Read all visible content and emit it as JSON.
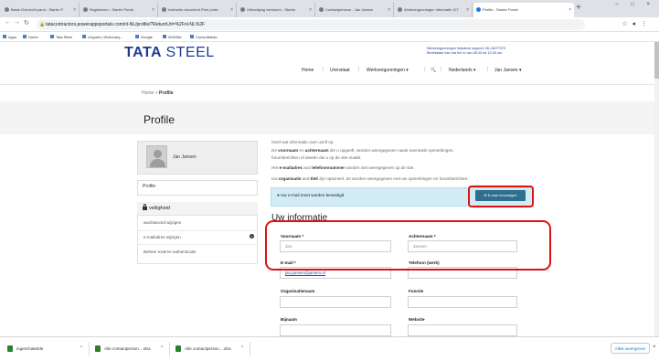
{
  "browser": {
    "tabs": [
      {
        "label": "Basis Overzicht pand - Starter P"
      },
      {
        "label": "Registreren - Starter Portal"
      },
      {
        "label": "Instructie document Prim porta"
      },
      {
        "label": "Uitnodiging versturen - Starter"
      },
      {
        "label": "Contactpersoon - Jan Jansen"
      },
      {
        "label": "Werkvergunningen Informatie ICT"
      },
      {
        "label": "Profile - Starter Portal"
      }
    ],
    "new_tab": "+",
    "window_controls": "– □ ×",
    "url": "tatacontractors.powerappsportals.com/nl-NL/profile/?ReturnUrl=%2Fnl-NL%2F",
    "bookmarks": [
      "Apps",
      "Home",
      "Tata Steel",
      "Linguee | Dictionary...",
      "Google",
      "WvSSet",
      "Consudebalo"
    ]
  },
  "site": {
    "logo_main": "TATA",
    "logo_sub": "STEEL",
    "help_line1": "Werkvergunningen helpdesk support: 06-11677970",
    "help_line2": "Bereikbaar van ma t/m vr van 08.00 tot 12.00 uur",
    "nav": {
      "home": "Home",
      "urenstaat": "Urenstaat",
      "werkvergunningen": "Werkvergunningen ▾",
      "search": "🔍",
      "language": "Nederlands ▾",
      "user": "Jan Jansen ▾"
    }
  },
  "page": {
    "breadcrumb_home": "Home",
    "breadcrumb_sep": ">",
    "breadcrumb_current": "Profile",
    "title": "Profile"
  },
  "sidebar": {
    "user_name": "Jan Jansen",
    "profile_label": "Profile",
    "security_label": "veiligheid",
    "items": [
      {
        "label": "wachtwoord wijzigen"
      },
      {
        "label": "e-mailadres wijzigen"
      },
      {
        "label": "Beheer externe authenticatie"
      }
    ]
  },
  "intro": {
    "line1": "Geef wat informatie over uzelf op.",
    "line2a": "De ",
    "line2b": "voornaam",
    "line2c": " en ",
    "line2d": "achternaam",
    "line2e": " die u opgeeft, worden weergegeven naast eventuele opmerkingen,",
    "line3": "forumberichten of ideeën die u op de site maakt.",
    "line4a": "Het ",
    "line4b": "e-mailadres",
    "line4c": " and ",
    "line4d": "telefoonnummer",
    "line4e": " worden niet weergegeven op de site.",
    "line5a": "Uw ",
    "line5b": "organisatie",
    "line5c": " and ",
    "line5d": "titel",
    "line5e": " zijn optioneel. Ze worden weergegeven met uw opmerkingen en forumberichten."
  },
  "alert": {
    "text": "Uw e-mail moet worden bevestigd",
    "button": "E-mail bevestigen"
  },
  "form": {
    "section_title": "Uw informatie",
    "voornaam_label": "Voornaam *",
    "voornaam_value": "Jan",
    "achternaam_label": "Achternaam *",
    "achternaam_value": "Jansen",
    "email_label": "E-mail *",
    "email_value": "jan.jansen@jansen.nl",
    "telefoon_label": "Telefoon (werk)",
    "telefoon_value": "",
    "organisatie_label": "Organisatienaam",
    "functie_label": "Functie",
    "bijnaam_label": "Bijnaam",
    "website_label": "Website"
  },
  "downloads": {
    "items": [
      {
        "label": "ingeschakelde"
      },
      {
        "label": "Alle contactperson....xlsx"
      },
      {
        "label": "Alle contactperson....xlsx"
      }
    ],
    "show_all": "Alles weergeven",
    "close": "×"
  },
  "colors": {
    "brand_blue": "#1c3d8f",
    "alert_bg": "#d2ecf6",
    "button_bg": "#2f6f8e",
    "highlight_red": "#e01010"
  }
}
